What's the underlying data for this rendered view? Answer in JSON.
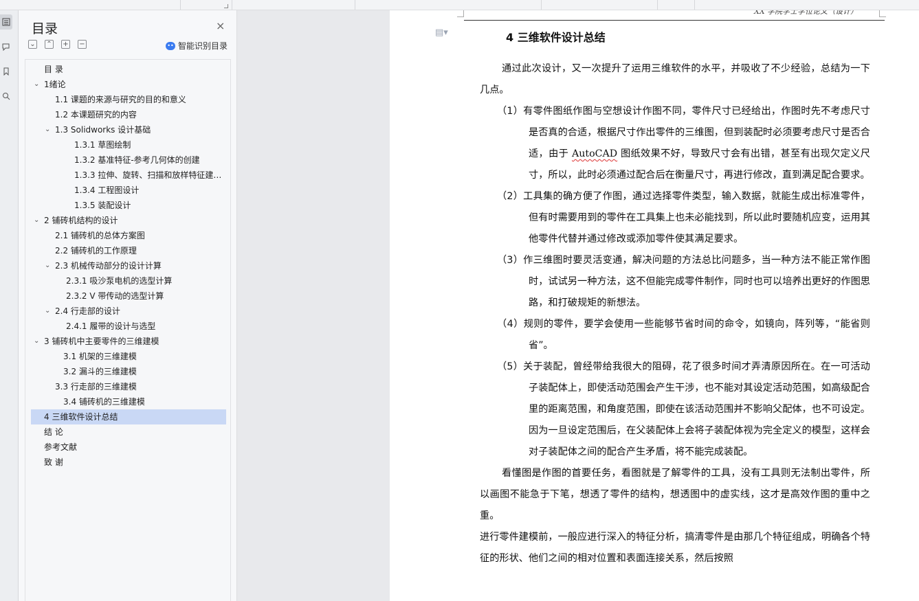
{
  "toc_panel": {
    "title": "目录",
    "close_glyph": "×",
    "tools": [
      "⌄",
      "⌃",
      "+",
      "−"
    ],
    "smart_label": "智能识别目录",
    "items": [
      {
        "text": "目  录",
        "level": 0,
        "caret": ""
      },
      {
        "text": "1绪论",
        "level": 0,
        "caret": "⌄"
      },
      {
        "text": "1.1 课题的来源与研究的目的和意义",
        "level": 1,
        "caret": ""
      },
      {
        "text": "1.2 本课题研究的内容",
        "level": 1,
        "caret": ""
      },
      {
        "text": "1.3 Solidworks 设计基础",
        "level": 1,
        "caret": "⌄"
      },
      {
        "text": "1.3.1  草图绘制",
        "level": 2,
        "caret": ""
      },
      {
        "text": "1.3.2  基准特征-参考几何体的创建",
        "level": 2,
        "caret": ""
      },
      {
        "text": "1.3.3 拉伸、旋转、扫描和放样特征建…",
        "level": 2,
        "caret": ""
      },
      {
        "text": "1.3.4 工程图设计",
        "level": 2,
        "caret": ""
      },
      {
        "text": "1.3.5 装配设计",
        "level": 2,
        "caret": ""
      },
      {
        "text": "2  铺砖机结构的设计",
        "level": 0,
        "caret": "⌄"
      },
      {
        "text": "2.1  铺砖机的总体方案图",
        "level": 1,
        "caret": ""
      },
      {
        "text": "2.2  铺砖机的工作原理",
        "level": 1,
        "caret": ""
      },
      {
        "text": "2.3  机械传动部分的设计计算",
        "level": 1,
        "caret": "⌄"
      },
      {
        "text": "2.3.1 吸沙泵电机的选型计算",
        "level": 3,
        "caret": ""
      },
      {
        "text": "2.3.2 V 带传动的选型计算",
        "level": 3,
        "caret": ""
      },
      {
        "text": "2.4  行走部的设计",
        "level": 1,
        "caret": "⌄"
      },
      {
        "text": "2.4.1  履带的设计与选型",
        "level": 3,
        "caret": ""
      },
      {
        "text": "3  铺砖机中主要零件的三维建模",
        "level": 0,
        "caret": "⌄"
      },
      {
        "text": "3.1 机架的三维建模",
        "level": 4,
        "caret": ""
      },
      {
        "text": "3.2 漏斗的三维建模",
        "level": 4,
        "caret": ""
      },
      {
        "text": "3.3  行走部的三维建模",
        "level": 1,
        "caret": ""
      },
      {
        "text": "3.4 铺砖机的三维建模",
        "level": 4,
        "caret": ""
      },
      {
        "text": "4  三维软件设计总结",
        "level": 0,
        "caret": "",
        "selected": true
      },
      {
        "text": "结    论",
        "level": 0,
        "caret": ""
      },
      {
        "text": "参考文献",
        "level": 0,
        "caret": ""
      },
      {
        "text": "致    谢",
        "level": 0,
        "caret": ""
      }
    ]
  },
  "page": {
    "header_text": "XX 学院学士学位论文（设计）",
    "heading": "4  三维软件设计总结",
    "intro": "通过此次设计，又一次提升了运用三维软件的水平，并吸收了不少经验，总结为一下几点。",
    "items": [
      {
        "parts": [
          {
            "t": "（1）有零件图纸作图与空想设计作图不同，零件尺寸已经给出，作图时先不考虑尺寸是否真的合适，根据尺寸作出零件的三维图，但到装配时必须要考虑尺寸是否合适，由于 "
          },
          {
            "t": "AutoCAD",
            "wavy": true
          },
          {
            "t": " 图纸效果不好，导致尺寸会有出错，甚至有出现欠定义尺寸，所以，此时必须通过配合后在衡量尺寸，再进行修改，直到满足配合要求。"
          }
        ]
      },
      {
        "parts": [
          {
            "t": "（2）工具集的确方便了作图，通过选择零件类型，输入数据，就能生成出标准零件，但有时需要用到的零件在工具集上也未必能找到，所以此时要随机应变，运用其他零件代替并通过修改或添加零件使其满足要求。"
          }
        ]
      },
      {
        "parts": [
          {
            "t": "（3）作三维图时要灵活变通，解决问题的方法总比问题多，当一种方法不能正常作图时，试试另一种方法，这不但能完成零件制作，同时也可以培养出更好的作图思路，和打破规矩的新想法。"
          }
        ]
      },
      {
        "parts": [
          {
            "t": "（4）规则的零件，要学会使用一些能够节省时间的命令，如镜向，阵列等，“能省则省”。"
          }
        ]
      },
      {
        "parts": [
          {
            "t": "（5）关于装配，曾经带给我很大的阻碍，花了很多时间才弄清原因所在。在一可活动子装配体上，即使活动范围会产生干涉，也不能对其设定活动范围，如高级配合里的距离范围，和角度范围，即使在该活动范围并不影响父配体，也不可设定。因为一旦设定范围后，在父装配体上会将子装配体视为完全定义的模型，这样会对子装配体之间的配合产生矛盾，将不能完成装配。"
          }
        ]
      }
    ],
    "para2": "看懂图是作图的首要任务，看图就是了解零件的工具，没有工具则无法制出零件，所以画图不能急于下笔，想透了零件的结构，想透图中的虚实线，这才是高效作图的重中之重。",
    "para3": "进行零件建模前，一般应进行深入的特征分析，搞清零件是由那几个特征组成，明确各个特征的形状、他们之间的相对位置和表面连接关系，然后按照"
  }
}
